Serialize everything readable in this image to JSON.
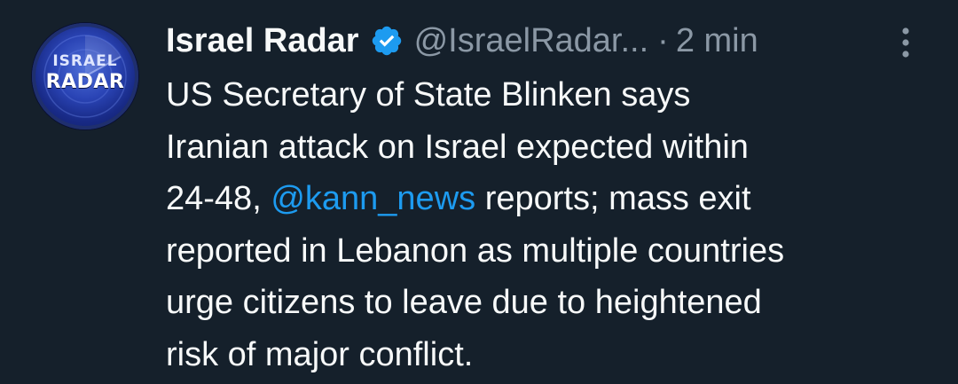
{
  "tweet": {
    "avatar": {
      "top_word": "ISRAEL",
      "bottom_word": "RADAR"
    },
    "author": {
      "display_name": "Israel Radar",
      "handle": "@IsraelRadar...",
      "verified": true
    },
    "separator": "·",
    "time": "2 min",
    "body_lines": [
      [
        {
          "text": "US Secretary of State Blinken says"
        }
      ],
      [
        {
          "text": "Iranian attack on Israel expected within"
        }
      ],
      [
        {
          "text": "24-48, "
        },
        {
          "mention": "@kann_news"
        },
        {
          "text": " reports; mass exit"
        }
      ],
      [
        {
          "text": "reported in Lebanon as multiple countries"
        }
      ],
      [
        {
          "text": "urge citizens to leave due to heightened"
        }
      ],
      [
        {
          "text": "risk of major conflict."
        }
      ]
    ]
  },
  "colors": {
    "background": "#15202b",
    "text": "#f7f9f9",
    "secondary_text": "#8b98a5",
    "link": "#1d9bf0",
    "verified_badge": "#1d9bf0"
  },
  "icons": {
    "verified": "verified-badge-icon",
    "more": "more-vertical-icon"
  }
}
